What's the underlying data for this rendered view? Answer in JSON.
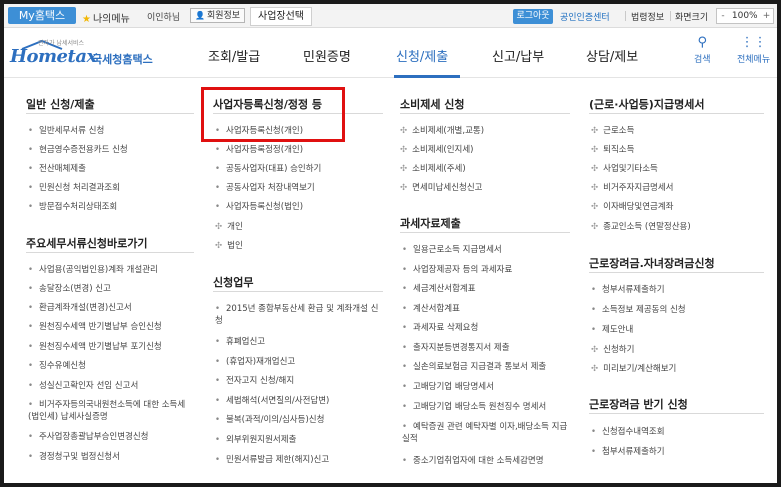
{
  "topbar": {
    "my_hometax": "My홈택스",
    "favorites": "나의메뉴",
    "user_name": "이인하님",
    "member_info": "회원정보",
    "tab_business": "사업장선택",
    "logout": "로그아웃",
    "cert_center": "공인인증센터",
    "legal_info": "법령정보",
    "screen_size": "화면크기",
    "zoom_minus": "-",
    "zoom_value": "100%",
    "zoom_plus": "+"
  },
  "header": {
    "logo_tagline": "전자가 납세서비스",
    "logo_text": "Hometax",
    "logo_sub": "국세청홈택스",
    "nav": [
      "조회/발급",
      "민원증명",
      "신청/제출",
      "신고/납부",
      "상담/제보"
    ],
    "active_nav": "신청/제출",
    "search_label": "검색",
    "all_menu_label": "전체메뉴",
    "brand_color": "#2d6fbf"
  },
  "columns": [
    {
      "sections": [
        {
          "title": "일반 신청/제출",
          "items": [
            "일반세무서류 신청",
            "현금영수증전용카드 신청",
            "전산매체제출",
            "민원신청 처리결과조회",
            "방문접수처리상태조회"
          ]
        },
        {
          "title": "주요세무서류신청바로가기",
          "items": [
            "사업용(공익법인용)계좌 개설관리",
            "송달장소(변경) 신고",
            "환급계좌개설(변경)신고서",
            "원천징수세액 반기별납부 승인신청",
            "원천징수세액 반기별납부 포기신청",
            "징수유예신청",
            "성실신고확인자 선임 신고서",
            "비거주자등의국내원천소득에 대한 소득세(법인세) 납세사실증명",
            "주사업장총괄납부승인변경신청",
            "경정청구및 법정신청서"
          ]
        }
      ]
    },
    {
      "sections": [
        {
          "title": "사업자등록신청/정정 등",
          "items": [
            "사업자등록신청(개인)",
            "사업자등록정정(개인)",
            "공동사업자(대표) 승인하기",
            "공동사업자 처장내역보기",
            "사업자등록신청(법인)",
            "개인",
            "법인"
          ]
        },
        {
          "title": "신청업무",
          "items": [
            "2015년 종합부동산세 환급 및 계좌개설 신청",
            "휴폐업신고",
            "(휴업자)재개업신고",
            "전자고지 신청/해지",
            "세법해석(서면질의/사전답변)",
            "불복(과적/이의/심사등)신청",
            "외부위원지원서제출",
            "민원서류발급 제한(해지)신고"
          ]
        }
      ]
    },
    {
      "sections": [
        {
          "title": "소비제세 신청",
          "items": [
            "소비제세(개별,교통)",
            "소비제세(인지세)",
            "소비제세(주세)",
            "면세미납세신청신고"
          ]
        },
        {
          "title": "과세자료제출",
          "items": [
            "일용근로소득 지급명세서",
            "사업장제공자 등의 과세자료",
            "세금계산서합계표",
            "계산서합계표",
            "과세자료 삭제요청",
            "출자지분등변경통지서 제출",
            "실손의료보험금 지급결과 통보서 제출",
            "고배당기업 배당명세서",
            "고배당기업 배당소득 원천징수 명세서",
            "예탁증권 관련 예탁자별 이자,배당소득 지급 실적",
            "중소기업취업자에 대한 소득세감면명"
          ]
        }
      ]
    },
    {
      "sections": [
        {
          "title": "(근로·사업등)지급명세서",
          "items": [
            "근로소득",
            "퇴직소득",
            "사업및기타소득",
            "비거주자지급명세서",
            "이자배당및연금계좌",
            "종교인소득 (연말정산용)"
          ]
        },
        {
          "title": "근로장려금.자녀장려금신청",
          "items": [
            "청부서류제출하기",
            "소득정보 제공동의 신청",
            "제도안내",
            "신청하기",
            "미리보기/계산해보기"
          ]
        },
        {
          "title": "근로장려금 반기 신청",
          "items": [
            "신청접수내역조회",
            "첨부서류제출하기"
          ]
        }
      ]
    }
  ]
}
